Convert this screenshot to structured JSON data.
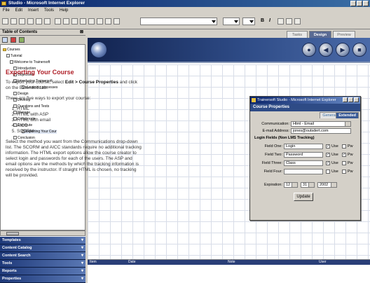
{
  "window": {
    "title": "Studio - Microsoft Internet Explorer"
  },
  "menu": [
    "File",
    "Edit",
    "Insert",
    "Tools",
    "Help"
  ],
  "toc": {
    "title": "Table of Contents",
    "close": "⊠",
    "tree": [
      {
        "label": "Courses",
        "level": 0
      },
      {
        "label": "Tutorial",
        "level": 1
      },
      {
        "label": "Welcome to Trainersoft",
        "level": 2
      },
      {
        "label": "Introduction",
        "level": 3
      },
      {
        "label": "Objectives",
        "level": 3
      },
      {
        "label": "Introducing Trainersoft",
        "level": 3
      },
      {
        "label": "eLearning processes",
        "level": 4
      },
      {
        "label": "Design",
        "level": 3
      },
      {
        "label": "Develop",
        "level": 3
      },
      {
        "label": "Questions and Tests",
        "level": 3
      },
      {
        "label": "Manage",
        "level": 3
      },
      {
        "label": "Collaborate",
        "level": 3
      },
      {
        "label": "Distribute",
        "level": 3
      },
      {
        "label": "Exporting Your Cour",
        "level": 4
      },
      {
        "label": "Conclusion",
        "level": 3
      }
    ]
  },
  "panels": [
    "Templates",
    "Content Catalog",
    "Content Search",
    "Tools",
    "Reports",
    "Properties"
  ],
  "tabs": [
    "Tasks",
    "Design",
    "Preview"
  ],
  "content": {
    "heading": "Exporting Your Course",
    "p1_pre": "To export your course, select ",
    "p1_bold": "Edit > Course Properties",
    "p1_post": " and click on the Extended tab.",
    "p2": "There are five ways to export your course:",
    "list": [
      "HTML",
      "HTML with ASP",
      "HTML with email",
      "AICC",
      "SCORM"
    ],
    "p3": "Select the method you want from the Communications drop-down list. The SCORM and AICC standards require no additional tracking information. The HTML export options allow the course creator to select login and passwords for each of the users. The ASP and email options are the methods by which the tracking information is received by the instructor. If straight HTML is chosen, no tracking will be provided."
  },
  "dialog": {
    "title": "Trainersoft Studio - Microsoft Internet Explorer",
    "header": "Course Properties",
    "tabs": [
      "General",
      "Extended"
    ],
    "communication_label": "Communication:",
    "communication_value": "Html - Email",
    "email_label": "E-mail Address:",
    "email_value": "jones@outsdert.com",
    "section": "Login Fields (Non LMS Tracking)",
    "fields": [
      {
        "label": "Field One:",
        "value": "Login",
        "use": true,
        "pw": false
      },
      {
        "label": "Field Two:",
        "value": "Password",
        "use": true,
        "pw": true
      },
      {
        "label": "Field Three:",
        "value": "Class",
        "use": true,
        "pw": false
      },
      {
        "label": "Field Four:",
        "value": "",
        "use": false,
        "pw": false
      }
    ],
    "use_label": "Use",
    "pw_label": "Pw",
    "expiration_label": "Expiration:",
    "exp_month": "12",
    "exp_day": "31",
    "exp_year": "2002",
    "update_label": "Update"
  },
  "bottom": {
    "columns": [
      "Item",
      "Date",
      "Note",
      "User"
    ]
  }
}
